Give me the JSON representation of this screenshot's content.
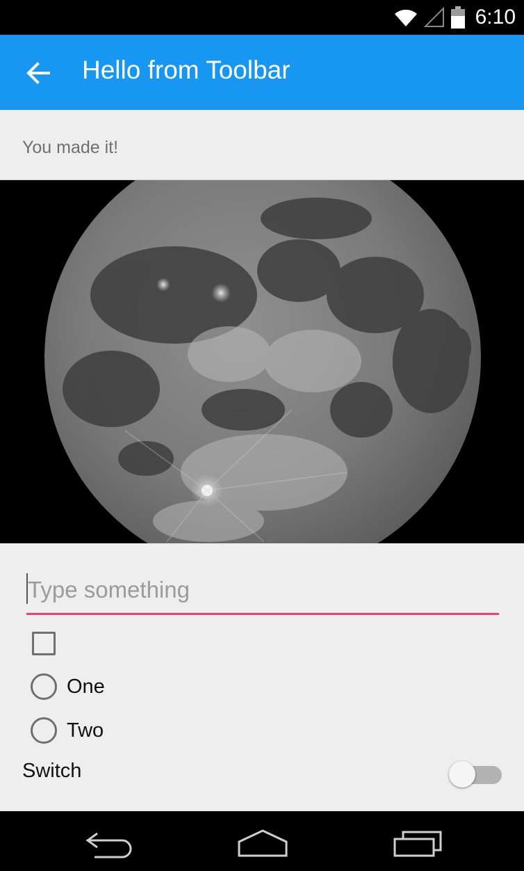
{
  "status_bar": {
    "time": "6:10",
    "icons": [
      "wifi-icon",
      "cell-signal-icon",
      "battery-icon"
    ]
  },
  "toolbar": {
    "title": "Hello from Toolbar",
    "back_icon": "arrow-back-icon",
    "background_color": "#1796f2"
  },
  "main": {
    "message": "You made it!",
    "image_subject": "moon",
    "text_field": {
      "value": "",
      "placeholder": "Type something",
      "underline_color": "#ee3f78"
    },
    "checkbox": {
      "checked": false
    },
    "radios": [
      {
        "label": "One",
        "selected": false
      },
      {
        "label": "Two",
        "selected": false
      }
    ],
    "switch": {
      "label": "Switch",
      "on": false
    }
  },
  "nav_bar": {
    "icons": [
      "back-nav-icon",
      "home-nav-icon",
      "recents-nav-icon"
    ]
  }
}
